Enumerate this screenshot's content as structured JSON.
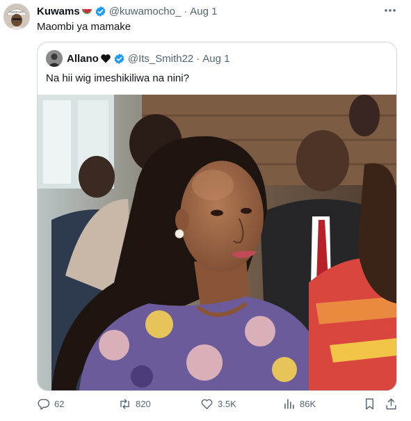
{
  "tweet": {
    "author_name": "Kuwams",
    "author_emoji": "watermelon-emoji",
    "handle": "@kuwamocho_",
    "separator": "·",
    "date": "Aug 1",
    "text": "Maombi ya mamake",
    "avatar_caption": "GOOD LIFE"
  },
  "quoted": {
    "author_name": "Allano",
    "author_emoji": "black-heart-emoji",
    "handle": "@Its_Smith22",
    "separator": "·",
    "date": "Aug 1",
    "text": "Na hii wig imeshikiliwa na nini?"
  },
  "actions": {
    "replies": "62",
    "retweets": "820",
    "likes": "3.5K",
    "views": "86K"
  },
  "colors": {
    "verified": "#1d9bf0",
    "text": "#0f1419",
    "secondary": "#536471",
    "border": "#cfd9de"
  }
}
